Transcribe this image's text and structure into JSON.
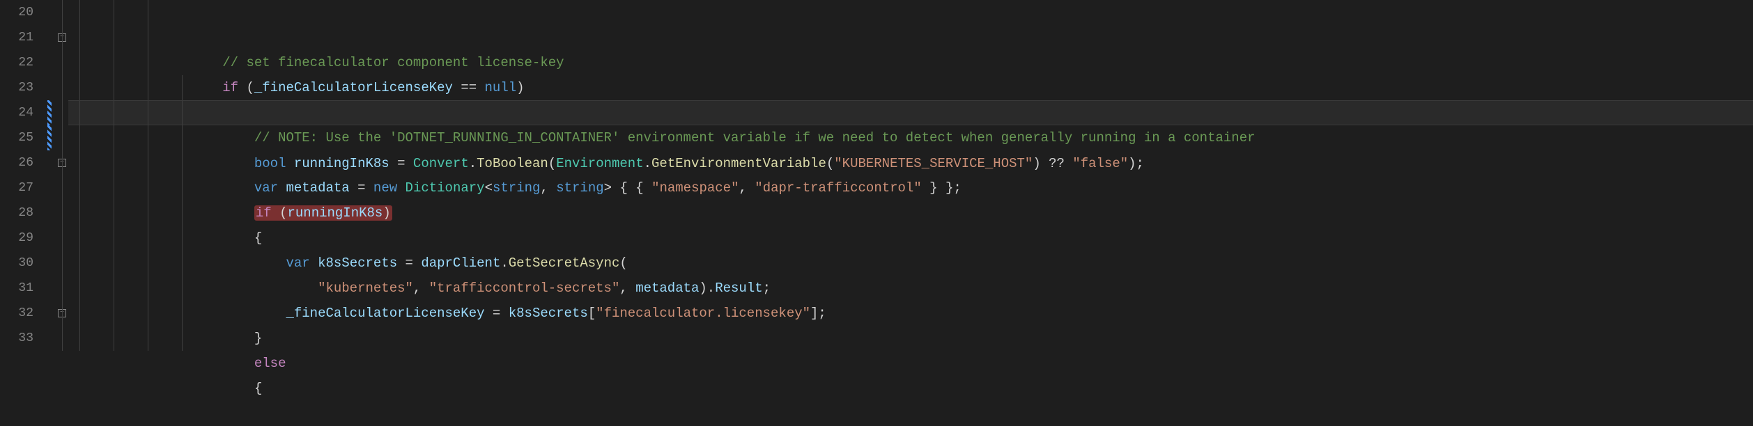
{
  "lineNumbers": [
    "20",
    "21",
    "22",
    "23",
    "24",
    "25",
    "26",
    "27",
    "28",
    "29",
    "30",
    "31",
    "32",
    "33"
  ],
  "code": {
    "l20": {
      "comment": "// set finecalculator component license-key"
    },
    "l21": {
      "kw_if": "if",
      "punct1": " (",
      "field": "_fineCalculatorLicenseKey",
      "op": " == ",
      "kw_null": "null",
      "punct2": ")"
    },
    "l22": {
      "brace": "{"
    },
    "l23": {
      "comment": "// NOTE: Use the 'DOTNET_RUNNING_IN_CONTAINER' environment variable if we need to detect when generally running in a container"
    },
    "l24": {
      "kw_bool": "bool",
      "var": " runningInK8s",
      "op": " = ",
      "cls1": "Convert",
      "dot1": ".",
      "m1": "ToBoolean",
      "p1": "(",
      "cls2": "Environment",
      "dot2": ".",
      "m2": "GetEnvironmentVariable",
      "p2": "(",
      "str1": "\"KUBERNETES_SERVICE_HOST\"",
      "p3": ") ?? ",
      "str2": "\"false\"",
      "p4": ");"
    },
    "l25": {
      "kw_var": "var",
      "var": " metadata",
      "op": " = ",
      "kw_new": "new",
      "sp": " ",
      "cls": "Dictionary",
      "lt": "<",
      "t1": "string",
      "comma": ", ",
      "t2": "string",
      "gt": ">",
      "p1": " { { ",
      "str1": "\"namespace\"",
      "c2": ", ",
      "str2": "\"dapr-trafficcontrol\"",
      "p2": " } };"
    },
    "l26": {
      "kw_if": "if",
      "p1": " (",
      "var": "runningInK8s",
      "p2": ")"
    },
    "l27": {
      "brace": "{"
    },
    "l28": {
      "kw_var": "var",
      "var": " k8sSecrets",
      "op": " = ",
      "obj": "daprClient",
      "dot": ".",
      "m": "GetSecretAsync",
      "p": "("
    },
    "l29": {
      "str1": "\"kubernetes\"",
      "c1": ", ",
      "str2": "\"trafficcontrol-secrets\"",
      "c2": ", ",
      "var": "metadata",
      "p": ").",
      "prop": "Result",
      "semi": ";"
    },
    "l30": {
      "field": "_fineCalculatorLicenseKey",
      "op": " = ",
      "var": "k8sSecrets",
      "p1": "[",
      "str": "\"finecalculator.licensekey\"",
      "p2": "];"
    },
    "l31": {
      "brace": "}"
    },
    "l32": {
      "kw_else": "else"
    },
    "l33": {
      "brace": "{"
    }
  },
  "glyph": {
    "line24_action": "quick-action"
  }
}
